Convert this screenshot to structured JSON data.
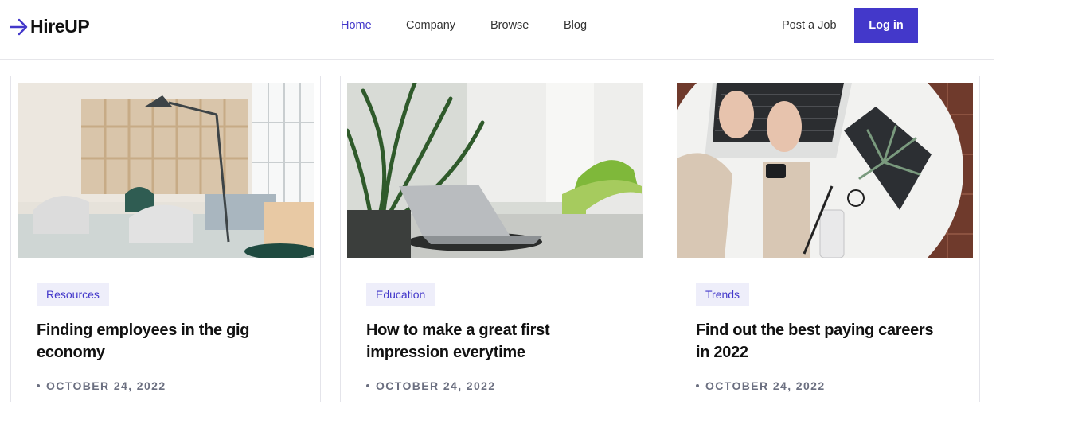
{
  "brand": {
    "name": "HireUP",
    "icon": "arrow-right-icon",
    "accent": "#4338ca"
  },
  "nav": {
    "items": [
      {
        "label": "Home",
        "active": true
      },
      {
        "label": "Company",
        "active": false
      },
      {
        "label": "Browse",
        "active": false
      },
      {
        "label": "Blog",
        "active": false
      }
    ],
    "post_job_label": "Post a Job",
    "login_label": "Log in"
  },
  "cards": [
    {
      "image": "office-lounge-photo",
      "tag": "Resources",
      "title": "Finding employees in the gig economy",
      "date": "OCTOBER 24, 2022"
    },
    {
      "image": "laptop-plant-photo",
      "tag": "Education",
      "title": "How to make a great first impression everytime",
      "date": "OCTOBER 24, 2022"
    },
    {
      "image": "typing-desk-photo",
      "tag": "Trends",
      "title": "Find out the best paying careers in 2022",
      "date": "OCTOBER 24, 2022"
    }
  ]
}
